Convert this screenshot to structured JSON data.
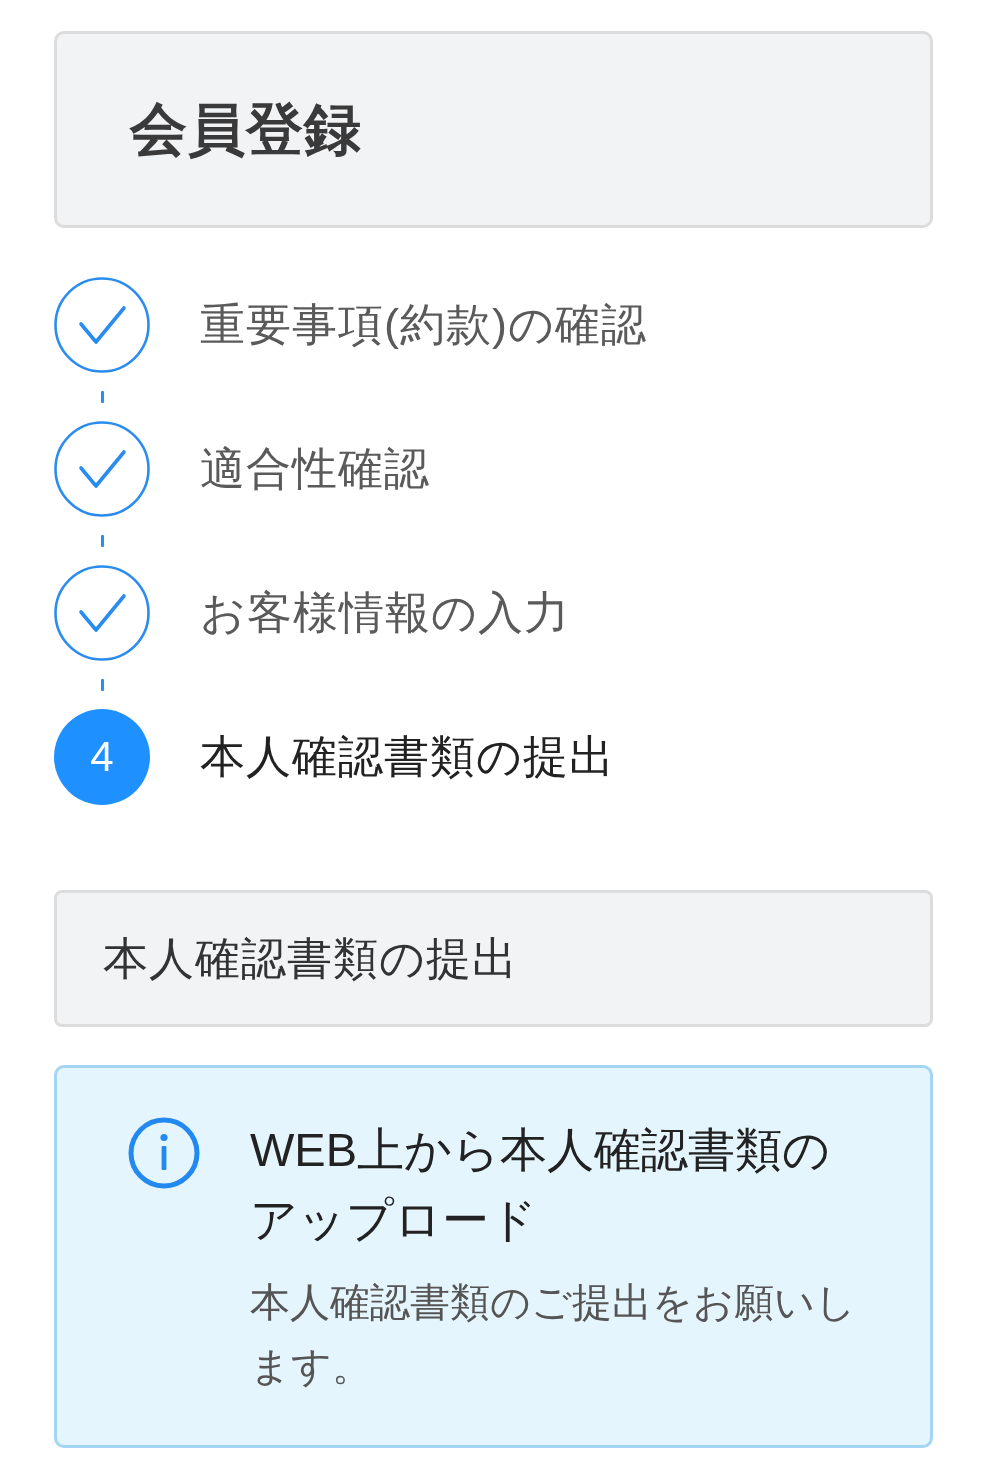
{
  "header": {
    "title": "会員登録"
  },
  "steps": [
    {
      "label": "重要事項(約款)の確認",
      "completed": true
    },
    {
      "label": "適合性確認",
      "completed": true
    },
    {
      "label": "お客様情報の入力",
      "completed": true
    },
    {
      "label": "本人確認書類の提出",
      "completed": false,
      "number": "4"
    }
  ],
  "section": {
    "title": "本人確認書類の提出"
  },
  "notice": {
    "title": "WEB上から本人確認書類のアップロード",
    "message": "本人確認書類のご提出をお願いします。"
  }
}
